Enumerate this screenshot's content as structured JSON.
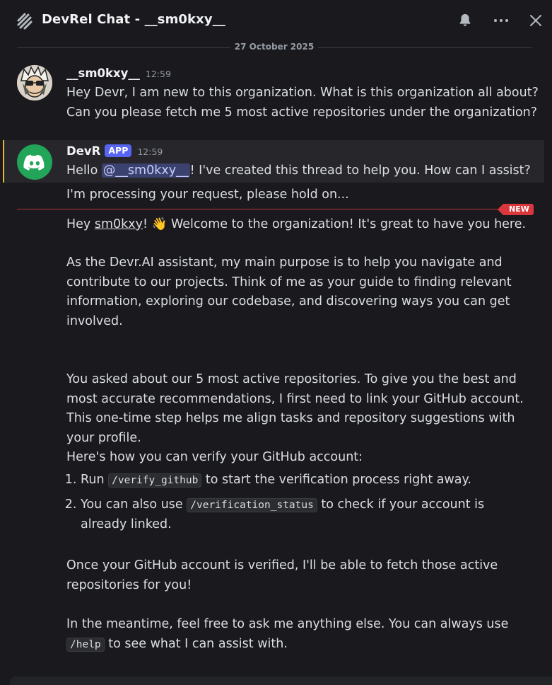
{
  "header": {
    "title": "DevRel Chat - __sm0kxy__",
    "icons": [
      "thread-icon",
      "bell-icon",
      "more-icon",
      "close-icon"
    ]
  },
  "date_divider": "27 October 2025",
  "messages": [
    {
      "author": "__sm0kxy__",
      "time": "12:59",
      "line1": "Hey Devr, I am new to this organization. What is this organization all about?",
      "line2": "Can you please fetch me 5 most active repositories under the organization?"
    },
    {
      "author": "DevR",
      "badge": "APP",
      "time": "12:59",
      "greeting_pre": "Hello ",
      "mention": "@__sm0kxy__",
      "greeting_post": "! I've created this thread to help you. How can I assist?",
      "processing": "I'm processing your request, please hold on..."
    }
  ],
  "new_badge": "NEW",
  "reply": {
    "p1_pre": "Hey ",
    "p1_user": "sm0kxy",
    "p1_post": "! ",
    "p1_emoji": "👋",
    "p1_rest": " Welcome to the organization! It's great to have you here.",
    "p2": "As the Devr.AI assistant, my main purpose is to help you navigate and contribute to our projects. Think of me as your guide to finding relevant information, exploring our codebase, and discovering ways you can get involved.",
    "p3": "You asked about our 5 most active repositories. To give you the best and most accurate recommendations, I first need to link your GitHub account. This one-time step helps me align tasks and repository suggestions with your profile.",
    "p4": "Here's how you can verify your GitHub account:",
    "li1_pre": "Run ",
    "li1_code": "/verify_github",
    "li1_post": " to start the verification process right away.",
    "li2_pre": "You can also use ",
    "li2_code": "/verification_status",
    "li2_post": " to check if your account is already linked.",
    "p5": "Once your GitHub account is verified, I'll be able to fetch those active repositories for you!",
    "p6_pre": "In the meantime, feel free to ask me anything else. You can always use ",
    "p6_code": "/help",
    "p6_post": " to see what I can assist with."
  },
  "colors": {
    "background": "#1a1a1e",
    "accent": "#5865f2",
    "new_red": "#da373c",
    "highlight_bar": "#f0b232"
  }
}
